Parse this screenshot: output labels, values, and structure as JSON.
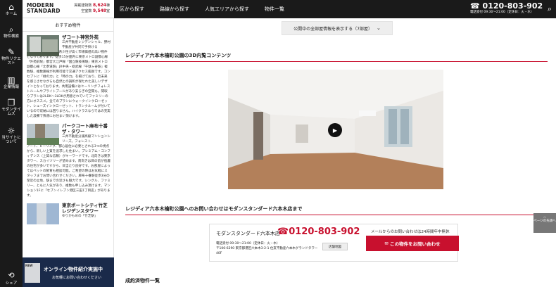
{
  "brand": {
    "logo_line1": "MODERN",
    "logo_line2": "STANDARD",
    "stat1_label": "掲載建物数",
    "stat1_value": "8,624",
    "stat1_unit": "棟",
    "stat2_label": "空室数",
    "stat2_value": "9,548",
    "stat2_unit": "室"
  },
  "sidebar": {
    "items": [
      {
        "label": "ホーム",
        "icon": "home-icon"
      },
      {
        "label": "物件検索",
        "icon": "search-icon"
      },
      {
        "label": "物件リクエスト",
        "icon": "document-icon"
      },
      {
        "label": "企業情報",
        "icon": "building-icon"
      },
      {
        "label": "モダンタイムズ",
        "icon": "book-icon"
      },
      {
        "label": "当サイトについて",
        "icon": "bulb-icon"
      }
    ],
    "share_label": "シェア"
  },
  "header": {
    "nav": [
      "区から探す",
      "路線から探す",
      "人気エリアから探す",
      "物件一覧"
    ],
    "phone": "0120-803-902",
    "hours": "電話受付 09:30～21:00（定休日：火・水）"
  },
  "recommend": {
    "title": "おすすめ物件",
    "items": [
      {
        "name": "ザコート神宮外苑",
        "desc_top": "三井不動産レジデンシャル、野村不動産が共同で手掛ける",
        "desc": "高級分譲マンション。希少性が高く市場価値の高い物件となっております。徒歩15分圏内に東京メトロ副都心線「外苑前駅」都営大江戸線「国立競技場駅」東京メトロ副都心線「北参道駅」JR中央・総武線「千駄ヶ谷駅」複数駅、複数路線が利用可能で交通アクセス抜群です。コンセプトに「緑の力」と「時の力」を掲げており、近未来を感じさせながらも自然との調和が保たれた美しいデザインとなっております。共用設備にはヒーリングフォレストルームやプライトプールがあり安らぎの空間も。間取りプランは2LDK～3LDKが用意されていてファミリーの方にオススメ。全てのプランにウォークインクローゼット、シューズインクローゼット、トランクルームが付いているので収納には困りません。ハイクラスならではの充実した設備で快適にお住まい頂けます。"
      },
      {
        "name": "パークコート麻布十番ザ・タワー",
        "desc_top": "三井不動産分譲高級マンションシリーズ。フォレスト、",
        "desc": "アート、ヒーリング、都心居住に必要とされる3つの視点から、新しい上質を追求した住まい。プレミアム・コンフィデンス（上質な信頼）がキーワードです。北向きは東京タワー、スカイツリーが望めます。南向きは目の前が低層の住宅が多いですから、日当たり良好です。お部屋によってはペットの飼育も相談可能。ご希望の際はお気軽にスタッフまでお問い合わせください。麻布十番駅徒歩3分の至近の立地、駅までの近さも魅力です。シングル、ファミリー、ともに人気があり、複数も申し込み頂けます。マンション1Fに「セブンイレブン港区三田1丁目店」があります。"
      },
      {
        "name": "東京ポートシティ竹芝レジデンスタワー",
        "desc_top": "ゆりかもめの「竹芝駅」",
        "desc": ""
      }
    ]
  },
  "banner": {
    "new_badge": "NEW",
    "title": "オンライン物件紹介実施中",
    "subtitle": "お気軽にお問い合わせください"
  },
  "main": {
    "expand_button": "公開中の全部屋情報を表示する（7部屋）",
    "section_3d_title": "レジディア六本木檜町公園の3D内覧コンテンツ",
    "section_inquiry_title": "レジディア六本木檜町公園へのお問い合わせはモダンスタンダード六本木店まで",
    "section_done_title": "成約済物件一覧"
  },
  "inquiry": {
    "store_name": "モダンスタンダード六本木店",
    "tel": "0120-803-902",
    "hours_line1": "電話受付 09:30～21:00（定休日：火・水）",
    "hours_line2": "〒106-6290 東京都港区六本木3-2-1 住友不動産六本木グランドタワー40F",
    "map_button": "店舗地図",
    "mail_note": "メールからのお問い合わせは24時間年中無休",
    "mail_button": "この物件をお問い合わせ"
  },
  "pagetop": {
    "label": "ページの先頭へ"
  },
  "colors": {
    "accent": "#c8102e",
    "dark": "#1a1a1a",
    "navy": "#1a2a4a"
  }
}
